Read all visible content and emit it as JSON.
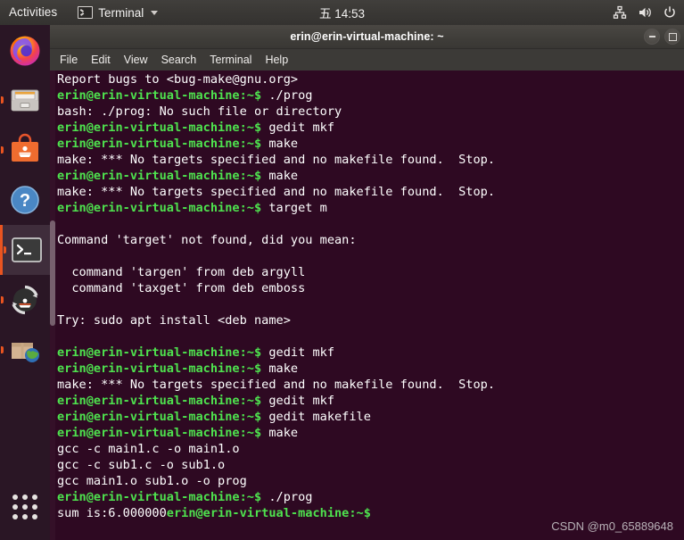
{
  "top_bar": {
    "activities": "Activities",
    "app_name": "Terminal",
    "app_icon": "terminal-icon",
    "clock": "五 14:53",
    "sys_icons": [
      "network-icon",
      "volume-icon",
      "power-icon"
    ]
  },
  "dock": {
    "items": [
      {
        "name": "firefox",
        "label": "Firefox",
        "running": false,
        "active": false
      },
      {
        "name": "files",
        "label": "Files",
        "running": true,
        "active": false
      },
      {
        "name": "ubuntu-software",
        "label": "Ubuntu Software",
        "running": true,
        "active": false
      },
      {
        "name": "help",
        "label": "Help",
        "running": false,
        "active": false
      },
      {
        "name": "terminal",
        "label": "Terminal",
        "running": true,
        "active": true
      },
      {
        "name": "software-updater",
        "label": "Software Updater",
        "running": true,
        "active": false
      },
      {
        "name": "package-globe",
        "label": "Install Software",
        "running": true,
        "active": false
      }
    ],
    "show_apps_label": "Show Applications"
  },
  "window": {
    "title": "erin@erin-virtual-machine: ~",
    "controls": {
      "minimize": "minimize-button",
      "maximize": "maximize-button"
    },
    "menu": [
      "File",
      "Edit",
      "View",
      "Search",
      "Terminal",
      "Help"
    ]
  },
  "terminal": {
    "prompt": "erin@erin-virtual-machine:~$ ",
    "lines": [
      {
        "type": "output",
        "text": "Report bugs to <bug-make@gnu.org>"
      },
      {
        "type": "command",
        "text": "./prog"
      },
      {
        "type": "output",
        "text": "bash: ./prog: No such file or directory"
      },
      {
        "type": "command",
        "text": "gedit mkf"
      },
      {
        "type": "command",
        "text": "make"
      },
      {
        "type": "output",
        "text": "make: *** No targets specified and no makefile found.  Stop."
      },
      {
        "type": "command",
        "text": "make"
      },
      {
        "type": "output",
        "text": "make: *** No targets specified and no makefile found.  Stop."
      },
      {
        "type": "command",
        "text": "target m"
      },
      {
        "type": "output",
        "text": ""
      },
      {
        "type": "output",
        "text": "Command 'target' not found, did you mean:"
      },
      {
        "type": "output",
        "text": ""
      },
      {
        "type": "output",
        "text": "  command 'targen' from deb argyll"
      },
      {
        "type": "output",
        "text": "  command 'taxget' from deb emboss"
      },
      {
        "type": "output",
        "text": ""
      },
      {
        "type": "output",
        "text": "Try: sudo apt install <deb name>"
      },
      {
        "type": "output",
        "text": ""
      },
      {
        "type": "command",
        "text": "gedit mkf"
      },
      {
        "type": "command",
        "text": "make"
      },
      {
        "type": "output",
        "text": "make: *** No targets specified and no makefile found.  Stop."
      },
      {
        "type": "command",
        "text": "gedit mkf"
      },
      {
        "type": "command",
        "text": "gedit makefile"
      },
      {
        "type": "command",
        "text": "make"
      },
      {
        "type": "output",
        "text": "gcc -c main1.c -o main1.o"
      },
      {
        "type": "output",
        "text": "gcc -c sub1.c -o sub1.o"
      },
      {
        "type": "output",
        "text": "gcc main1.o sub1.o -o prog"
      },
      {
        "type": "command",
        "text": "./prog"
      },
      {
        "type": "output_then_prompt",
        "text": "sum is:6.000000"
      }
    ]
  },
  "watermark": "CSDN @m0_65889648",
  "colors": {
    "terminal_bg": "#2e0922",
    "prompt_green": "#4ee24e",
    "output_white": "#ffffff",
    "accent_orange": "#e95420",
    "topbar_bg": "#3a3835"
  }
}
